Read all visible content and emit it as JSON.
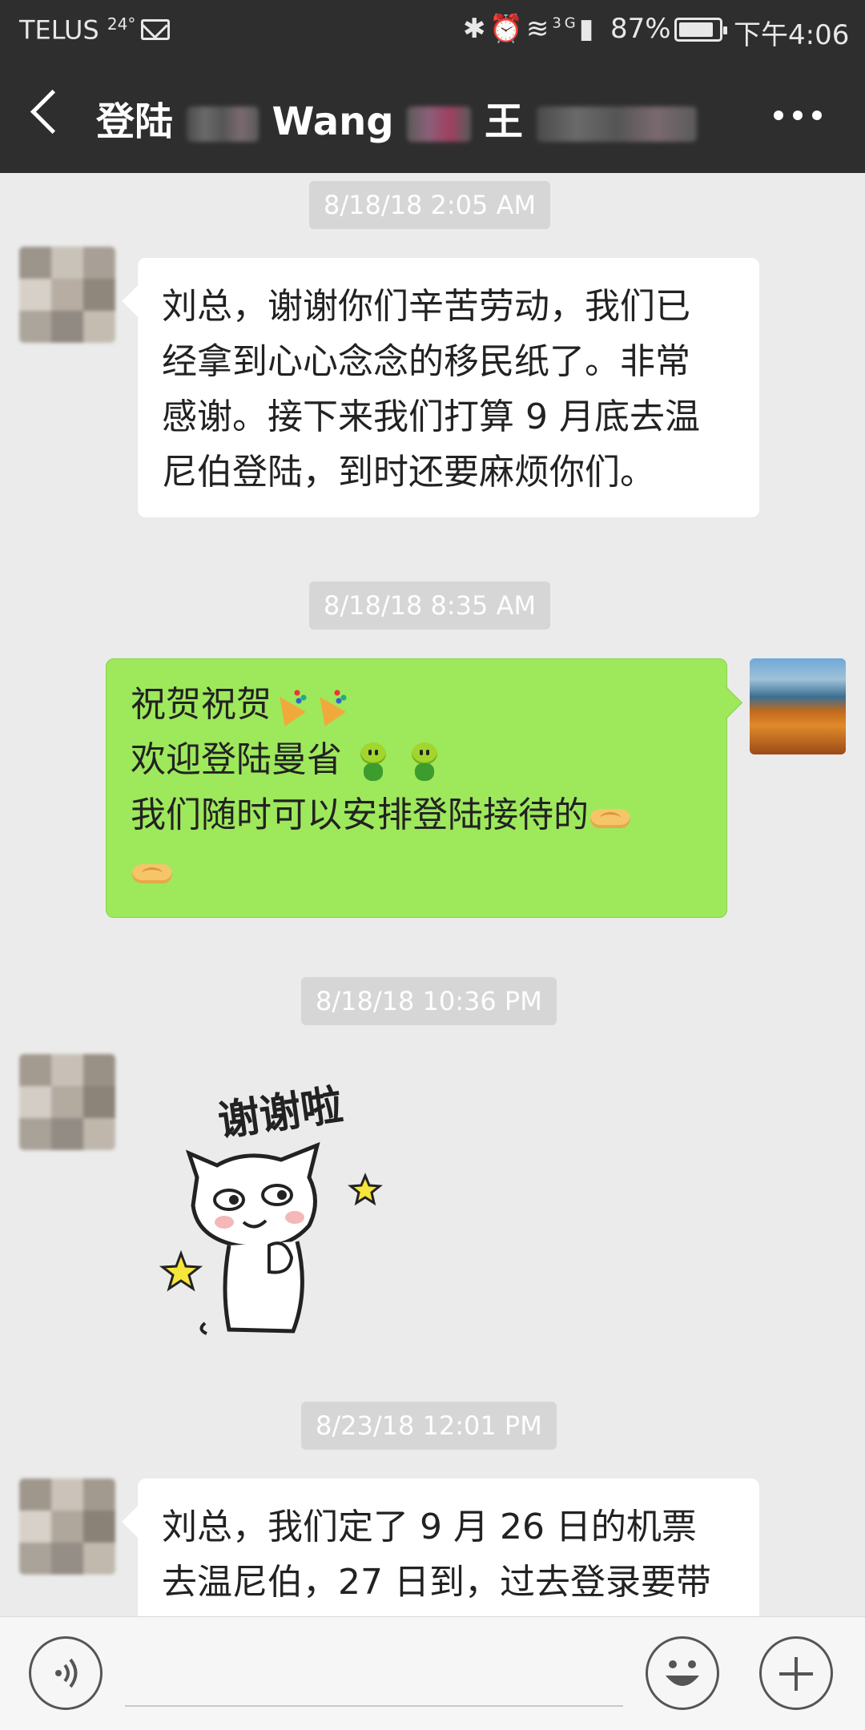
{
  "status_bar": {
    "carrier": "TELUS",
    "temperature": "24°",
    "network": "3G",
    "battery_percent": "87%",
    "battery_level": 0.87,
    "time": "下午4:06"
  },
  "header": {
    "title_part1": "登陆",
    "title_part2": "Wang",
    "title_part3": "王",
    "icons": [
      "back-icon",
      "more-icon"
    ]
  },
  "messages": [
    {
      "type": "timestamp",
      "text": "8/18/18 2:05 AM"
    },
    {
      "type": "text",
      "direction": "incoming",
      "lines": [
        "刘总，谢谢你们辛苦劳动，我们已",
        "经拿到心心念念的移民纸了。非常",
        "感谢。接下来我们打算 9 月底去温",
        "尼伯登陆，到时还要麻烦你们。"
      ]
    },
    {
      "type": "timestamp",
      "text": "8/18/18 8:35 AM"
    },
    {
      "type": "text",
      "direction": "outgoing",
      "lines": [
        "祝贺祝贺",
        "欢迎登陆曼省",
        "我们随时可以安排登陆接待的"
      ],
      "emoji": [
        "party-popper",
        "sprout-face",
        "handshake"
      ]
    },
    {
      "type": "timestamp",
      "text": "8/18/18 10:36 PM"
    },
    {
      "type": "sticker",
      "direction": "incoming",
      "caption": "谢谢啦"
    },
    {
      "type": "timestamp",
      "text": "8/23/18 12:01 PM"
    },
    {
      "type": "text",
      "direction": "incoming",
      "lines": [
        "刘总，我们定了 9 月 26 日的机票",
        "去温尼伯，27 日到，过去登录要带"
      ]
    }
  ],
  "input_bar": {
    "icons": [
      "voice-icon",
      "emoji-icon",
      "plus-icon"
    ]
  },
  "colors": {
    "header_bg": "#2e2e2e",
    "chat_bg": "#ebebeb",
    "outgoing_bubble": "#9ee85c",
    "incoming_bubble": "#ffffff",
    "timestamp_bg": "#d6d6d6"
  }
}
